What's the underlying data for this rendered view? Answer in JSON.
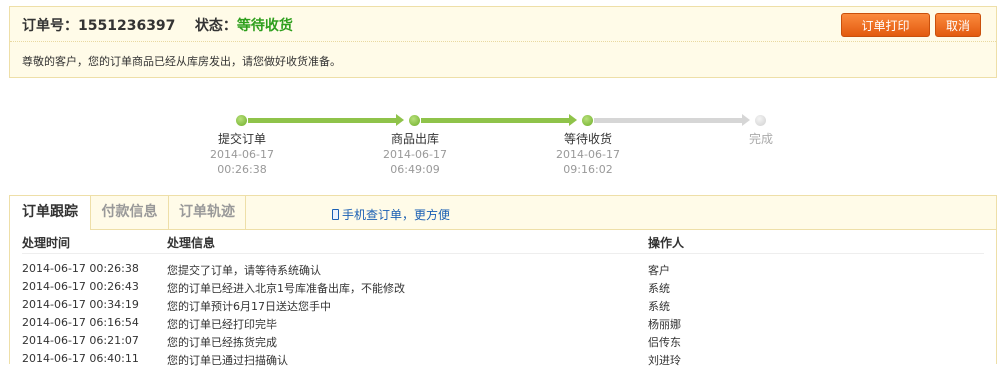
{
  "header": {
    "order_label": "订单号：",
    "order_number": "1551236397",
    "status_label": "状态：",
    "status_value": "等待收货",
    "print_button": "订单打印",
    "cancel_button": "取消",
    "notice": "尊敬的客户，您的订单商品已经从库房发出，请您做好收货准备。"
  },
  "progress": {
    "steps": [
      {
        "label": "提交订单",
        "date": "2014-06-17",
        "time": "00:26:38",
        "done": true
      },
      {
        "label": "商品出库",
        "date": "2014-06-17",
        "time": "06:49:09",
        "done": true
      },
      {
        "label": "等待收货",
        "date": "2014-06-17",
        "time": "09:16:02",
        "done": true
      },
      {
        "label": "完成",
        "date": "",
        "time": "",
        "done": false
      }
    ]
  },
  "tabs": {
    "items": [
      {
        "label": "订单跟踪"
      },
      {
        "label": "付款信息"
      },
      {
        "label": "订单轨迹"
      }
    ],
    "mobile_link": "手机查订单，更方便"
  },
  "tracking": {
    "columns": [
      "处理时间",
      "处理信息",
      "操作人"
    ],
    "rows": [
      [
        "2014-06-17 00:26:38",
        "您提交了订单，请等待系统确认",
        "客户"
      ],
      [
        "2014-06-17 00:26:43",
        "您的订单已经进入北京1号库准备出库，不能修改",
        "系统"
      ],
      [
        "2014-06-17 00:34:19",
        "您的订单预计6月17日送达您手中",
        "系统"
      ],
      [
        "2014-06-17 06:16:54",
        "您的订单已经打印完毕",
        "杨丽娜"
      ],
      [
        "2014-06-17 06:21:07",
        "您的订单已经拣货完成",
        "侣传东"
      ],
      [
        "2014-06-17 06:40:11",
        "您的订单已通过扫描确认",
        "刘进玲"
      ]
    ]
  }
}
